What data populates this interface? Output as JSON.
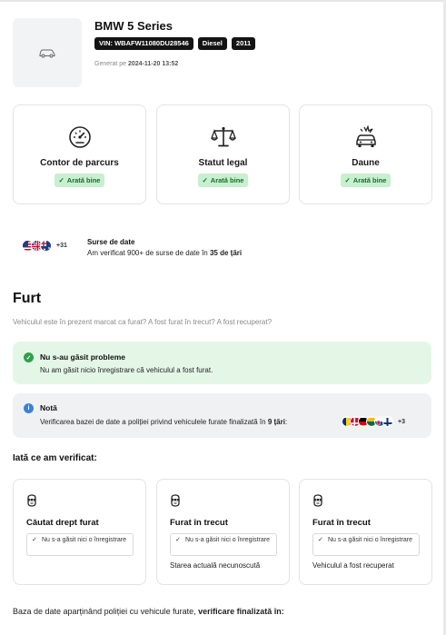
{
  "vehicle": {
    "title": "BMW 5 Series",
    "vin": "VIN: WBAFW11080DU28546",
    "fuel": "Diesel",
    "year": "2011",
    "generated_prefix": "Generat pe",
    "generated_date": "2024-11-20 13:52",
    "thumb_icon": "car-icon"
  },
  "status_cards": [
    {
      "label": "Contor de parcurs",
      "badge": "Arată bine",
      "icon": "speedometer-icon"
    },
    {
      "label": "Statut legal",
      "badge": "Arată bine",
      "icon": "scales-icon"
    },
    {
      "label": "Daune",
      "badge": "Arată bine",
      "icon": "car-crash-icon"
    }
  ],
  "sources": {
    "flags_more": "+31",
    "title": "Surse de date",
    "text_prefix": "Am verificat 900+ de surse de date în",
    "text_bold": "35 de țări"
  },
  "theft": {
    "title": "Furt",
    "description": "Vehiculul este în prezent marcat ca furat? A fost furat în trecut? A fost recuperat?",
    "ok_title": "Nu s-au găsit probleme",
    "ok_text": "Nu am găsit nicio înregistrare că vehiculul a fost furat.",
    "note_title": "Notă",
    "note_text_prefix": "Verificarea bazei de date a poliției privind vehiculele furate finalizată în",
    "note_text_bold": "9 țări",
    "note_text_suffix": ":",
    "note_flags_more": "+3",
    "checked_title": "Iată ce am verificat:",
    "checks": [
      {
        "title": "Căutat drept furat",
        "result": "Nu s-a găsit nici o înregistrare",
        "extra": ""
      },
      {
        "title": "Furat în trecut",
        "result": "Nu s-a găsit nici o înregistrare",
        "extra": "Starea actuală necunoscută"
      },
      {
        "title": "Furat în trecut",
        "result": "Nu s-a găsit nici o înregistrare",
        "extra": "Vehiculul a fost recuperat"
      }
    ],
    "footer_prefix": "Baza de date aparținând poliției cu vehicule furate,",
    "footer_bold": "verificare finalizată în:"
  },
  "colors": {
    "ok_badge_bg": "#c8efcf",
    "ok_badge_text": "#166d2a",
    "ok_alert_bg": "#e4f7e7",
    "note_alert_bg": "#f0f1f3",
    "tag_bg": "#141414"
  }
}
